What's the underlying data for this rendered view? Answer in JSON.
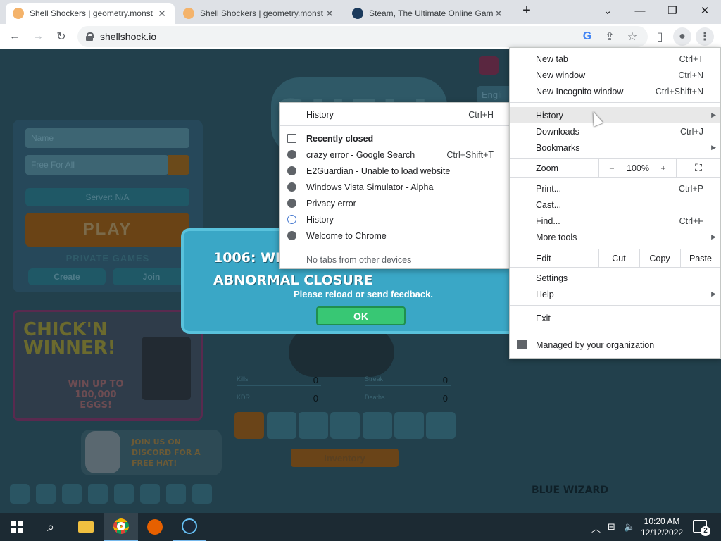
{
  "tabs": [
    {
      "title": "Shell Shockers | geometry.monst",
      "active": true
    },
    {
      "title": "Shell Shockers | geometry.monst",
      "active": false
    },
    {
      "title": "Steam, The Ultimate Online Gam",
      "active": false
    }
  ],
  "toolbar": {
    "url": "shellshock.io"
  },
  "page": {
    "logo": "SHELL",
    "name_placeholder": "Name",
    "mode": "Free For All",
    "server": "Server: N/A",
    "play": "PLAY",
    "private_games": "PRIVATE GAMES",
    "create": "Create",
    "join": "Join",
    "language": "Engli",
    "promo_title": "CHICK'N WINNER!",
    "promo_sub": "WIN UP TO 100,000 EGGS!",
    "discord": "JOIN US ON DISCORD FOR A FREE HAT!",
    "stats": [
      {
        "label": "Kills",
        "value": "0"
      },
      {
        "label": "Streak",
        "value": "0"
      },
      {
        "label": "KDR",
        "value": "0"
      },
      {
        "label": "Deaths",
        "value": "0"
      }
    ],
    "inventory": "Inventory",
    "brand": "BLUE WIZARD"
  },
  "dialog": {
    "title_line1": "1006: WE",
    "title_line2": "ABNORMAL CLOSURE",
    "message": "Please reload or send feedback.",
    "ok": "OK"
  },
  "menu": {
    "new_tab": {
      "label": "New tab",
      "shortcut": "Ctrl+T"
    },
    "new_window": {
      "label": "New window",
      "shortcut": "Ctrl+N"
    },
    "incognito": {
      "label": "New Incognito window",
      "shortcut": "Ctrl+Shift+N"
    },
    "history": {
      "label": "History"
    },
    "downloads": {
      "label": "Downloads",
      "shortcut": "Ctrl+J"
    },
    "bookmarks": {
      "label": "Bookmarks"
    },
    "zoom": {
      "label": "Zoom",
      "minus": "−",
      "value": "100%",
      "plus": "+"
    },
    "print": {
      "label": "Print...",
      "shortcut": "Ctrl+P"
    },
    "cast": {
      "label": "Cast..."
    },
    "find": {
      "label": "Find...",
      "shortcut": "Ctrl+F"
    },
    "more_tools": {
      "label": "More tools"
    },
    "edit": {
      "label": "Edit",
      "cut": "Cut",
      "copy": "Copy",
      "paste": "Paste"
    },
    "settings": {
      "label": "Settings"
    },
    "help": {
      "label": "Help"
    },
    "exit": {
      "label": "Exit"
    },
    "managed": {
      "label": "Managed by your organization"
    }
  },
  "history_menu": {
    "history": {
      "label": "History",
      "shortcut": "Ctrl+H"
    },
    "recently_closed": "Recently closed",
    "items": [
      {
        "label": "crazy error - Google Search",
        "shortcut": "Ctrl+Shift+T"
      },
      {
        "label": "E2Guardian - Unable to load website",
        "shortcut": ""
      },
      {
        "label": "Windows Vista Simulator - Alpha",
        "shortcut": ""
      },
      {
        "label": "Privacy error",
        "shortcut": ""
      },
      {
        "label": "History",
        "shortcut": ""
      },
      {
        "label": "Welcome to Chrome",
        "shortcut": ""
      }
    ],
    "no_tabs": "No tabs from other devices"
  },
  "taskbar": {
    "time": "10:20 AM",
    "date": "12/12/2022",
    "notifications": "2"
  },
  "colors": {
    "accent": "#1a73e8",
    "dialog": "#3aa7c6",
    "ok": "#38c774"
  }
}
